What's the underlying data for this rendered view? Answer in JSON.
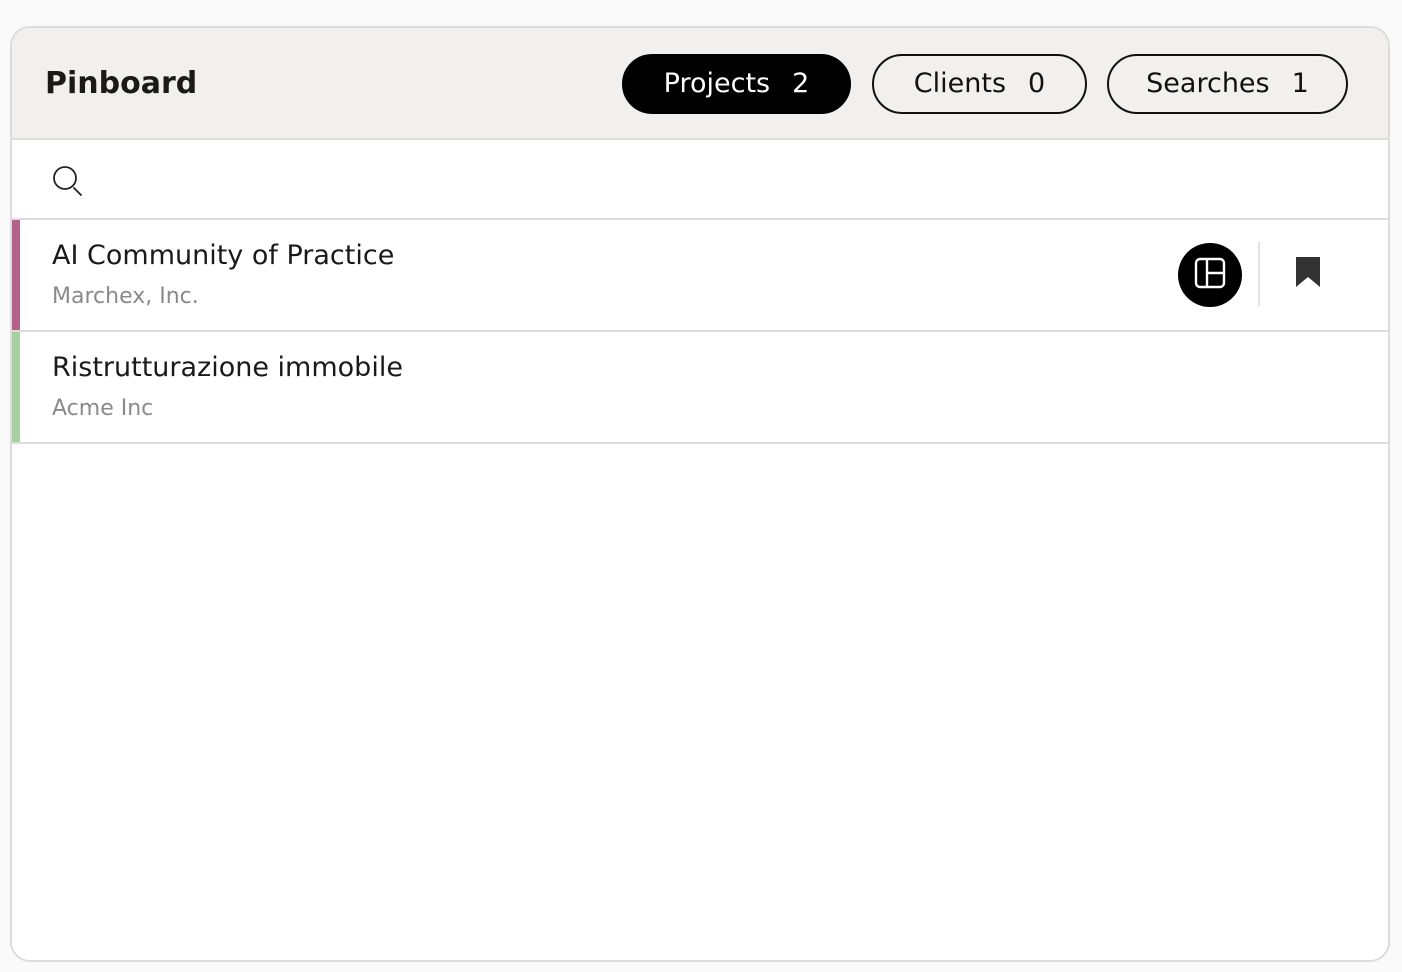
{
  "header": {
    "title": "Pinboard",
    "tabs": [
      {
        "label": "Projects",
        "count": "2",
        "active": true
      },
      {
        "label": "Clients",
        "count": "0",
        "active": false
      },
      {
        "label": "Searches",
        "count": "1",
        "active": false
      }
    ]
  },
  "search": {
    "value": "",
    "placeholder": "",
    "icon": "search-icon"
  },
  "projects": [
    {
      "name": "AI Community of Practice",
      "client": "Marchex, Inc.",
      "accent_color": "#b5608d",
      "actions": {
        "layout_icon": "layout-icon",
        "bookmark_icon": "bookmark-icon"
      }
    },
    {
      "name": "Ristrutturazione immobile",
      "client": "Acme Inc",
      "accent_color": "#a7cfa1"
    }
  ],
  "colors": {
    "active_tab_bg": "#000000",
    "header_bg": "#f1f0ee",
    "border": "#dcdcdc",
    "secondary_text": "#8a8a8a"
  }
}
